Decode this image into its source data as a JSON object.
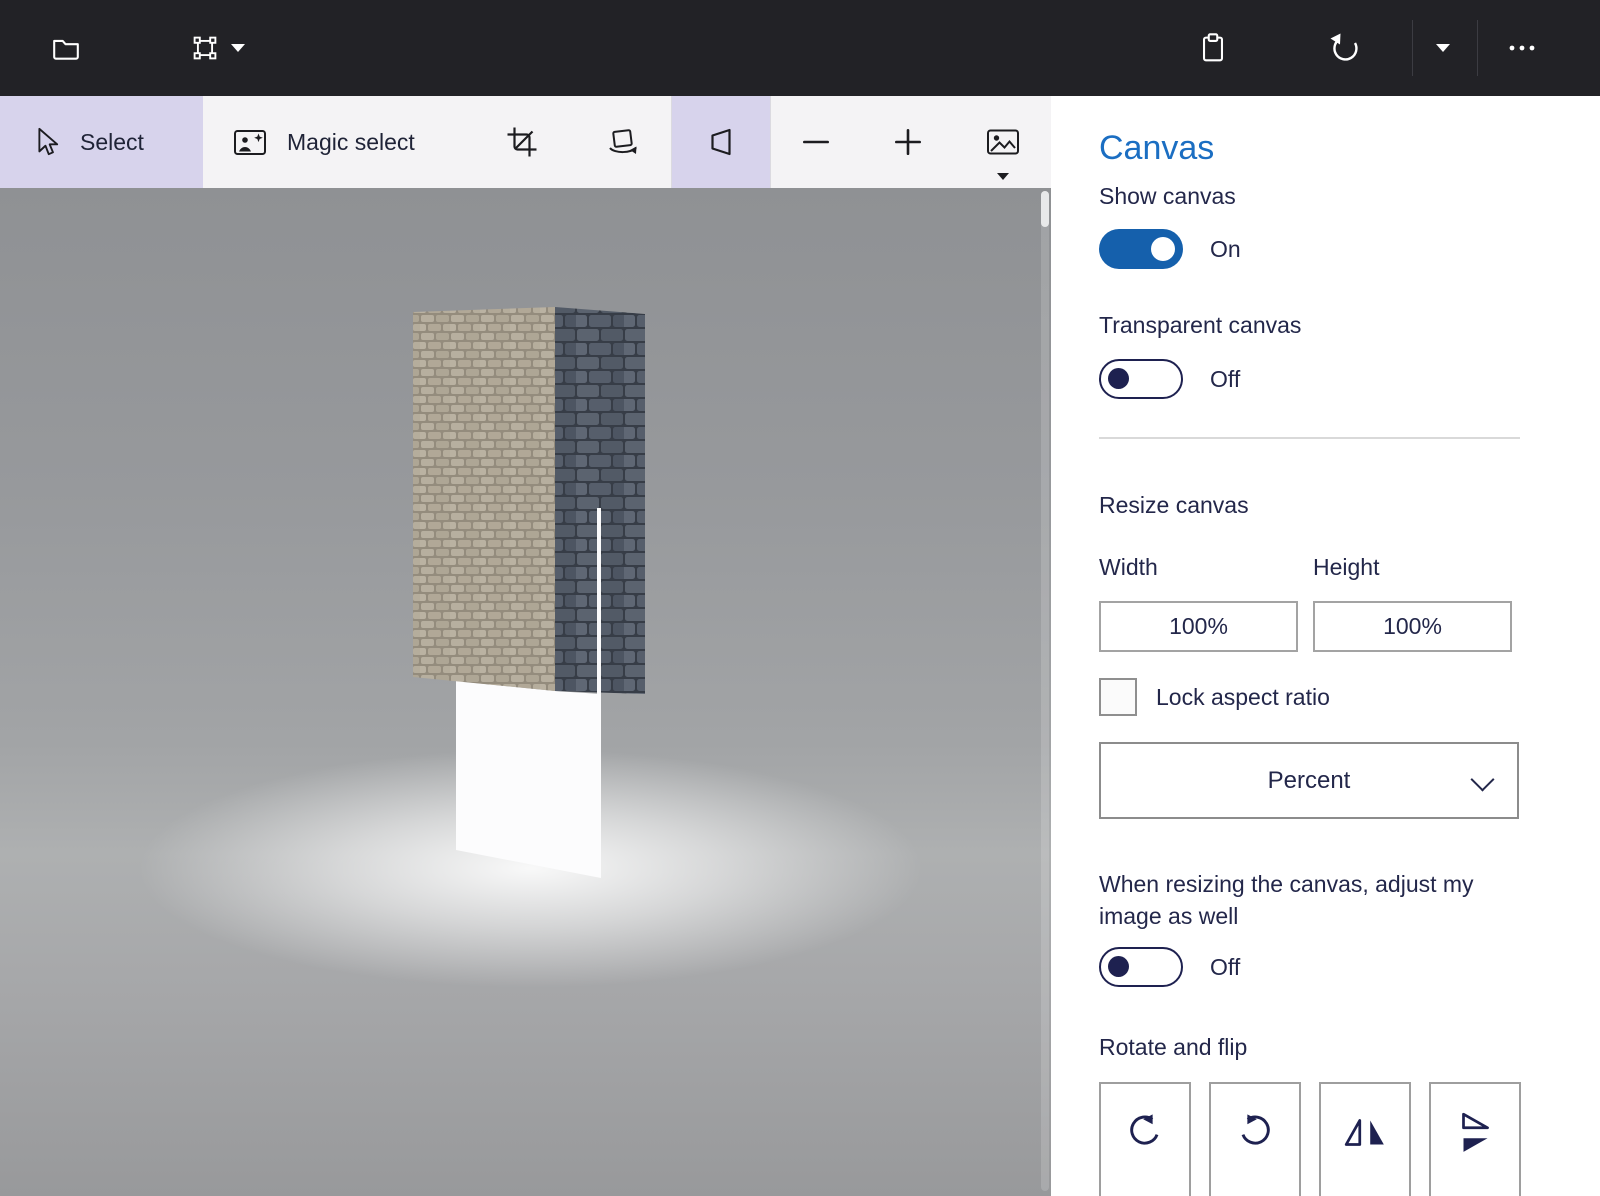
{
  "colors": {
    "accent": "#1b6ec2",
    "toggle_on": "#1560ac",
    "ink": "#23274a",
    "navy": "#1e2150",
    "titlebar_bg": "#222226",
    "toolbar_bg": "#f4f3f5",
    "highlight": "#d7d3ec"
  },
  "toolbar": {
    "select_label": "Select",
    "magic_select_label": "Magic select"
  },
  "panel": {
    "title": "Canvas",
    "show_canvas": {
      "label": "Show canvas",
      "state": "On"
    },
    "transparent_canvas": {
      "label": "Transparent canvas",
      "state": "Off"
    },
    "resize": {
      "heading": "Resize canvas",
      "width_label": "Width",
      "height_label": "Height",
      "width_value": "100%",
      "height_value": "100%",
      "lock_aspect_label": "Lock aspect ratio",
      "unit_value": "Percent"
    },
    "adjust": {
      "text": "When resizing the canvas, adjust my image as well",
      "state": "Off"
    },
    "rotate_flip": {
      "heading": "Rotate and flip"
    }
  }
}
